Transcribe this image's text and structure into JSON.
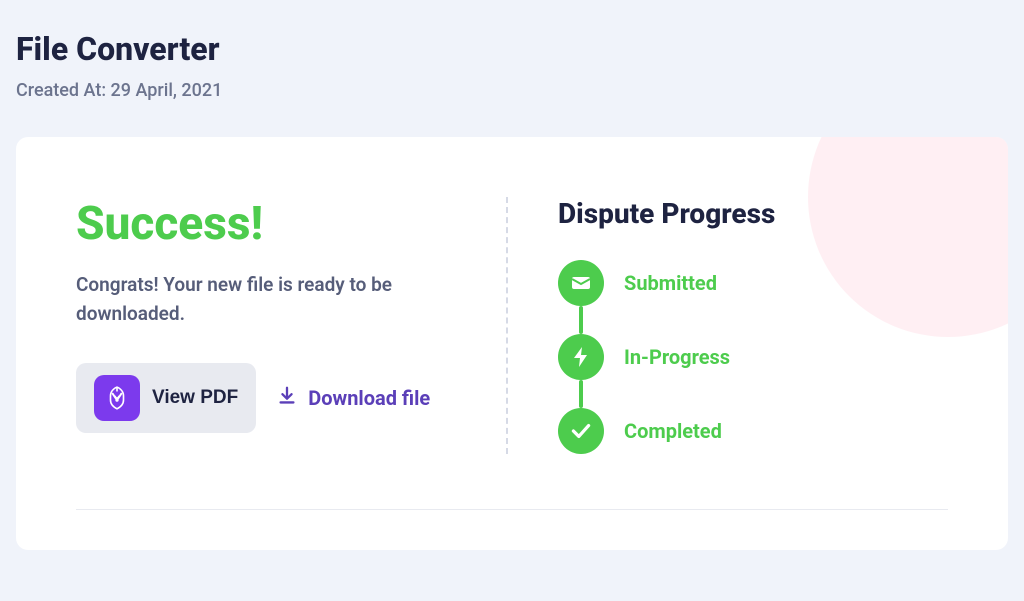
{
  "header": {
    "title": "File Converter",
    "created_at": "Created At: 29 April, 2021"
  },
  "success": {
    "title": "Success!",
    "message": "Congrats! Your new file is ready to be downloaded.",
    "view_pdf_label": "View PDF",
    "download_label": "Download file"
  },
  "progress": {
    "title": "Dispute Progress",
    "steps": {
      "s1": "Submitted",
      "s2": "In-Progress",
      "s3": "Completed"
    }
  }
}
